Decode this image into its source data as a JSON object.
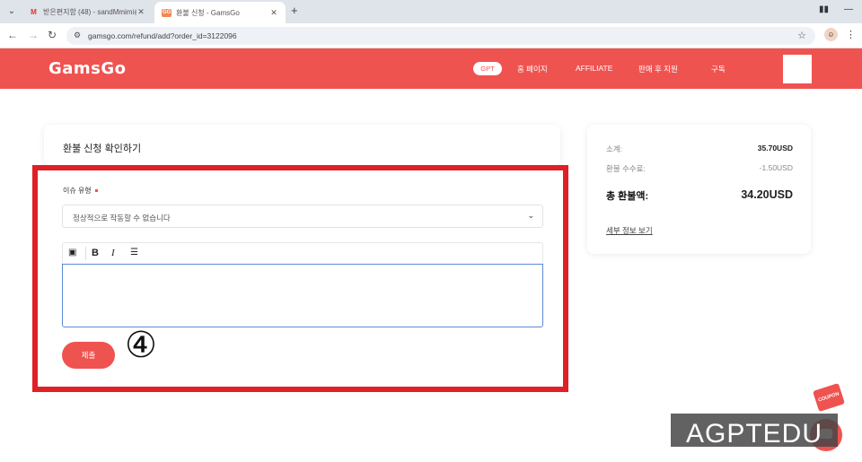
{
  "browser": {
    "tabs": [
      {
        "title": "받은편지함 (48) - sandMmimi@...",
        "favicon": "gmail-icon"
      },
      {
        "title": "환불 신청 - GamsGo",
        "favicon": "gamsgo-icon"
      }
    ],
    "url": "gamsgo.com/refund/add?order_id=3122096"
  },
  "header": {
    "logo": "GamsGo",
    "gpt": "GPT",
    "nav": [
      "홈 페이지",
      "AFFILIATE",
      "판매 후 지원",
      "구독"
    ]
  },
  "form": {
    "title": "환불 신청 확인하기",
    "issue_label": "이슈 유형",
    "issue_value": "정상적으로 작동할 수 없습니다",
    "submit": "제출",
    "step": "④"
  },
  "summary": {
    "subtotal_label": "소계:",
    "subtotal": "35.70USD",
    "fee_label": "환불 수수료:",
    "fee": "-1.50USD",
    "total_label": "총 환불액:",
    "total": "34.20USD",
    "details_link": "세부 정보 보기"
  },
  "widgets": {
    "coupon": "COUPON",
    "watermark": "AGPTEDU"
  }
}
